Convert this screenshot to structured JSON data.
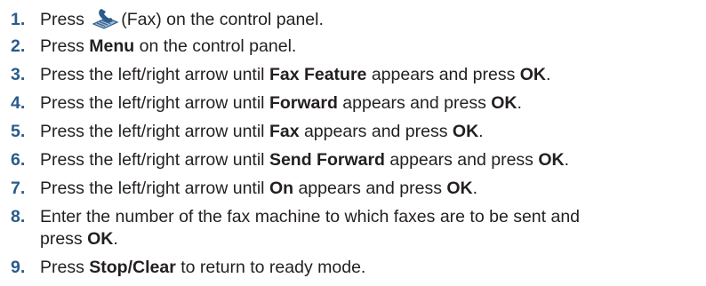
{
  "steps": [
    {
      "number": "1.",
      "pre": "Press ",
      "post": "(Fax) on the control panel.",
      "icon": "fax-icon"
    },
    {
      "number": "2.",
      "pre": "Press ",
      "bold1": "Menu",
      "post": " on the control panel."
    },
    {
      "number": "3.",
      "pre": "Press the left/right arrow until ",
      "bold1": "Fax Feature",
      "mid": " appears and press ",
      "bold2": "OK",
      "post": "."
    },
    {
      "number": "4.",
      "pre": "Press the left/right arrow until ",
      "bold1": "Forward",
      "mid": " appears and press ",
      "bold2": "OK",
      "post": "."
    },
    {
      "number": "5.",
      "pre": "Press the left/right arrow until ",
      "bold1": "Fax",
      "mid": " appears and press ",
      "bold2": "OK",
      "post": "."
    },
    {
      "number": "6.",
      "pre": "Press the left/right arrow until ",
      "bold1": "Send Forward",
      "mid": " appears and press ",
      "bold2": "OK",
      "post": "."
    },
    {
      "number": "7.",
      "pre": "Press the left/right arrow until ",
      "bold1": "On",
      "mid": " appears and press ",
      "bold2": "OK",
      "post": "."
    },
    {
      "number": "8.",
      "line1": "Enter the number of the fax machine to which faxes are to be sent and",
      "line2_pre": "press ",
      "bold1": "OK",
      "post": "."
    },
    {
      "number": "9.",
      "pre": "Press ",
      "bold1": "Stop/Clear",
      "post": " to return to ready mode."
    }
  ]
}
